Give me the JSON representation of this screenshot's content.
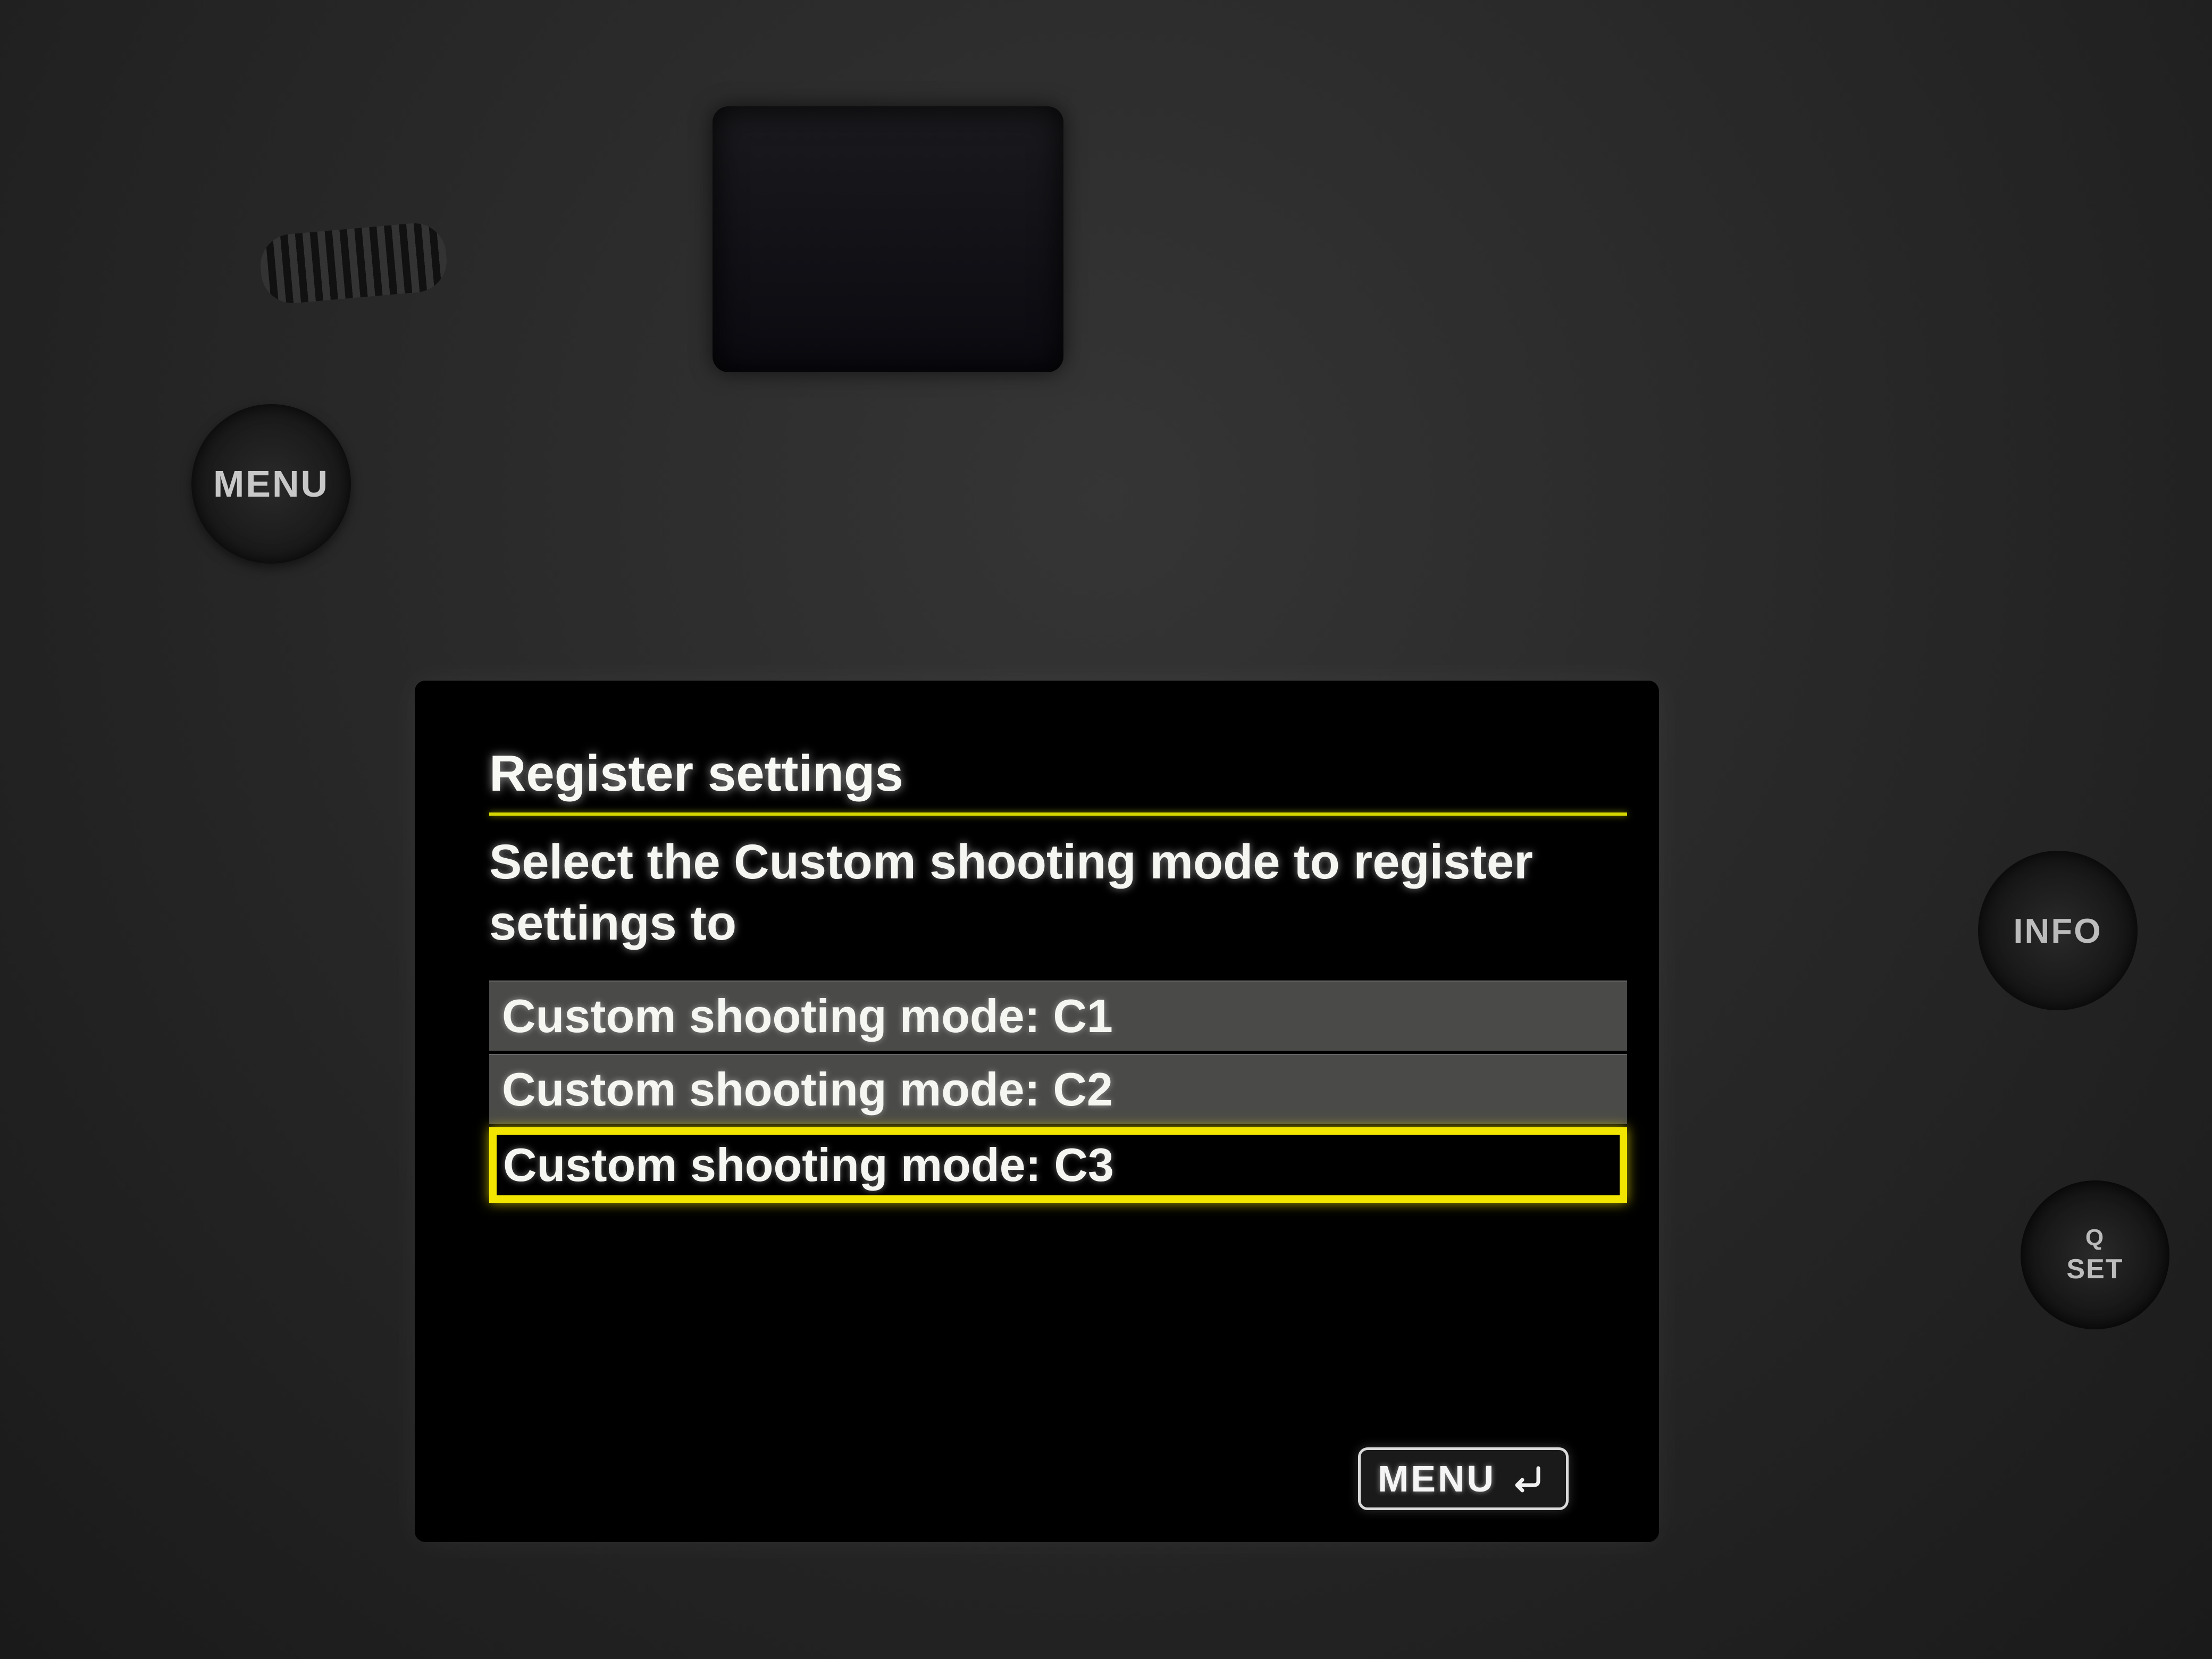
{
  "screen": {
    "title": "Register settings",
    "instruction": "Select the Custom shooting mode to register settings to",
    "options": [
      {
        "label": "Custom shooting mode: C1",
        "selected": false
      },
      {
        "label": "Custom shooting mode: C2",
        "selected": false
      },
      {
        "label": "Custom shooting mode: C3",
        "selected": true
      }
    ],
    "footer_label": "MENU"
  },
  "buttons": {
    "menu": "MENU",
    "info": "INFO",
    "set_q": "Q",
    "set": "SET"
  },
  "colors": {
    "accent": "#f2e600",
    "text": "#f5f5f2",
    "bg": "#000000"
  }
}
